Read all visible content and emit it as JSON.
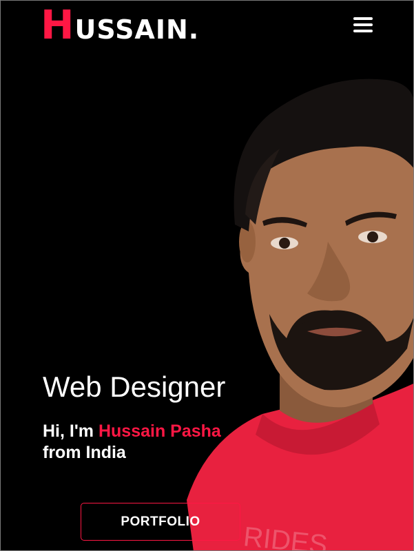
{
  "header": {
    "logo_first": "H",
    "logo_rest": "USSAIN.",
    "menu_icon": "hamburger-menu-icon"
  },
  "hero": {
    "title": "Web Designer",
    "intro_prefix": "Hi, I'm ",
    "name": "Hussain Pasha",
    "intro_suffix": "from India",
    "portfolio_label": "PORTFOLIO"
  },
  "colors": {
    "accent": "#ff1744",
    "background": "#000000",
    "text": "#ffffff",
    "shirt": "#e8213f"
  }
}
